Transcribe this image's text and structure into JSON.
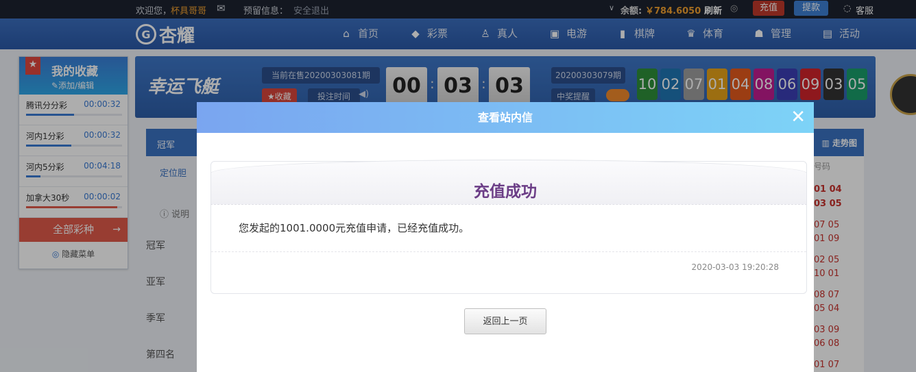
{
  "topbar": {
    "welcome": "欢迎您，",
    "username": "杯具哥哥",
    "reserved_info": "预留信息：",
    "logout": "安全退出",
    "balance_label": "余额:",
    "balance_value": "￥784.6050",
    "refresh": "刷新",
    "recharge": "充值",
    "withdraw": "提款",
    "service": "客服"
  },
  "logo": {
    "text": "杏耀"
  },
  "nav": {
    "items": [
      {
        "label": "首页",
        "icon": "home-icon"
      },
      {
        "label": "彩票",
        "icon": "ticket-icon"
      },
      {
        "label": "真人",
        "icon": "person-icon"
      },
      {
        "label": "电游",
        "icon": "slot-icon"
      },
      {
        "label": "棋牌",
        "icon": "cards-icon"
      },
      {
        "label": "体育",
        "icon": "trophy-icon"
      },
      {
        "label": "管理",
        "icon": "users-icon"
      },
      {
        "label": "活动",
        "icon": "gift-icon"
      }
    ]
  },
  "favorites": {
    "title": "我的收藏",
    "edit": "添加/编辑",
    "items": [
      {
        "name": "腾讯分分彩",
        "time": "00:00:32",
        "progress": 0.5
      },
      {
        "name": "河内1分彩",
        "time": "00:00:32",
        "progress": 0.47
      },
      {
        "name": "河内5分彩",
        "time": "00:04:18",
        "progress": 0.15
      },
      {
        "name": "加拿大30秒",
        "time": "00:00:02",
        "progress": 0.95
      }
    ],
    "all_games": "全部彩种",
    "hide_menu": "隐藏菜单"
  },
  "game": {
    "name": "幸运飞艇",
    "current_issue": "当前在售20200303081期",
    "collect": "收藏",
    "bet_time": "投注时间",
    "countdown": [
      "00",
      "03",
      "03"
    ],
    "last_issue": "20200303079期",
    "win_alert": "中奖提醒",
    "results": [
      "10",
      "02",
      "07",
      "01",
      "04",
      "08",
      "06",
      "09",
      "03",
      "05"
    ],
    "ball_colors": [
      "#2f8f3a",
      "#1f77b4",
      "#9e9e9e",
      "#e6a21a",
      "#e55a1c",
      "#c21c8f",
      "#3b3fb6",
      "#d1242c",
      "#333333",
      "#1a9e6a"
    ]
  },
  "tabs": {
    "first": "冠军",
    "trend": "走势图"
  },
  "subtabs": {
    "position": "定位胆",
    "explain": "说明",
    "code_header": "号码"
  },
  "rows": [
    "冠军",
    "亚军",
    "季军",
    "第四名"
  ],
  "right_numbers": [
    "01 04",
    "03 05",
    "07 05",
    "01 09",
    "02 05",
    "10 01",
    "08 07",
    "05 04",
    "03 09",
    "06 08",
    "01 07"
  ],
  "modal": {
    "title": "查看站内信",
    "heading": "充值成功",
    "message": "您发起的1001.0000元充值申请，已经充值成功。",
    "date": "2020-03-03 19:20:28",
    "back_button": "返回上一页"
  }
}
